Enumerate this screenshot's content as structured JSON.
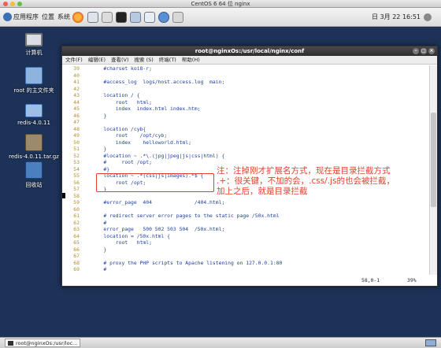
{
  "host": {
    "title": "CentOS 6 64 位 nginx"
  },
  "panel": {
    "menus": [
      "应用程序",
      "位置",
      "系统"
    ],
    "clock": "日 3月 22 16:51"
  },
  "desktop": {
    "icons": [
      {
        "label": "计算机",
        "icon": "computer-icon"
      },
      {
        "label": "root 的主文件夹",
        "icon": "home-folder-icon"
      },
      {
        "label": "redis-4.0.11",
        "icon": "folder-icon"
      },
      {
        "label": "redis-4.0.11.tar.gz",
        "icon": "archive-icon"
      },
      {
        "label": "回收站",
        "icon": "trash-icon"
      }
    ]
  },
  "terminal": {
    "title": "root@nginxOs:/usr/local/nginx/conf",
    "menu": [
      "文件(F)",
      "编辑(E)",
      "查看(V)",
      "搜索 (S)",
      "终端(T)",
      "帮助(H)"
    ],
    "lines": [
      {
        "n": "39",
        "t": "    #charset koi8-r;"
      },
      {
        "n": "40",
        "t": ""
      },
      {
        "n": "41",
        "t": "    #access_log  logs/host.access.log  main;"
      },
      {
        "n": "42",
        "t": ""
      },
      {
        "n": "43",
        "t": "    location / {"
      },
      {
        "n": "44",
        "t": "        root   html;"
      },
      {
        "n": "45",
        "t": "        index  index.html index.htm;"
      },
      {
        "n": "46",
        "t": "    }"
      },
      {
        "n": "47",
        "t": ""
      },
      {
        "n": "48",
        "t": "    location /cyb{"
      },
      {
        "n": "49",
        "t": "        root    /opt/cyb;"
      },
      {
        "n": "50",
        "t": "        index    helloworld.html;"
      },
      {
        "n": "51",
        "t": "    }"
      },
      {
        "n": "52",
        "t": "    #location ~ .*\\.(jpg|jpeg|js|css|html) {"
      },
      {
        "n": "53",
        "t": "    #     root /opt;"
      },
      {
        "n": "54",
        "t": "    #}"
      },
      {
        "n": "55",
        "t": "    location ~ .*(css|js|images).*$ {"
      },
      {
        "n": "56",
        "t": "        root /opt;"
      },
      {
        "n": "57",
        "t": "    }"
      },
      {
        "n": "58",
        "t": ""
      },
      {
        "n": "59",
        "t": "    #error_page  404              /404.html;"
      },
      {
        "n": "60",
        "t": ""
      },
      {
        "n": "61",
        "t": "    # redirect server error pages to the static page /50x.html"
      },
      {
        "n": "62",
        "t": "    #"
      },
      {
        "n": "63",
        "t": "    error_page   500 502 503 504  /50x.html;"
      },
      {
        "n": "64",
        "t": "    location = /50x.html {"
      },
      {
        "n": "65",
        "t": "        root   html;"
      },
      {
        "n": "66",
        "t": "    }"
      },
      {
        "n": "67",
        "t": ""
      },
      {
        "n": "68",
        "t": "    # proxy the PHP scripts to Apache listening on 127.0.0.1:80"
      },
      {
        "n": "69",
        "t": "    #"
      }
    ],
    "status_pos": "58,0-1",
    "status_pct": "39%"
  },
  "annotation": {
    "lines": [
      "注：注掉刚才扩展名方式，现在是目录拦截方式",
      ".+：很关键，不加的会，.css/.js的也会被拦截，",
      "加上之后，就是目录拦截"
    ],
    "color": "#e2422c"
  },
  "taskbar": {
    "task_label": "root@nginxOs:/usr/loc..."
  }
}
